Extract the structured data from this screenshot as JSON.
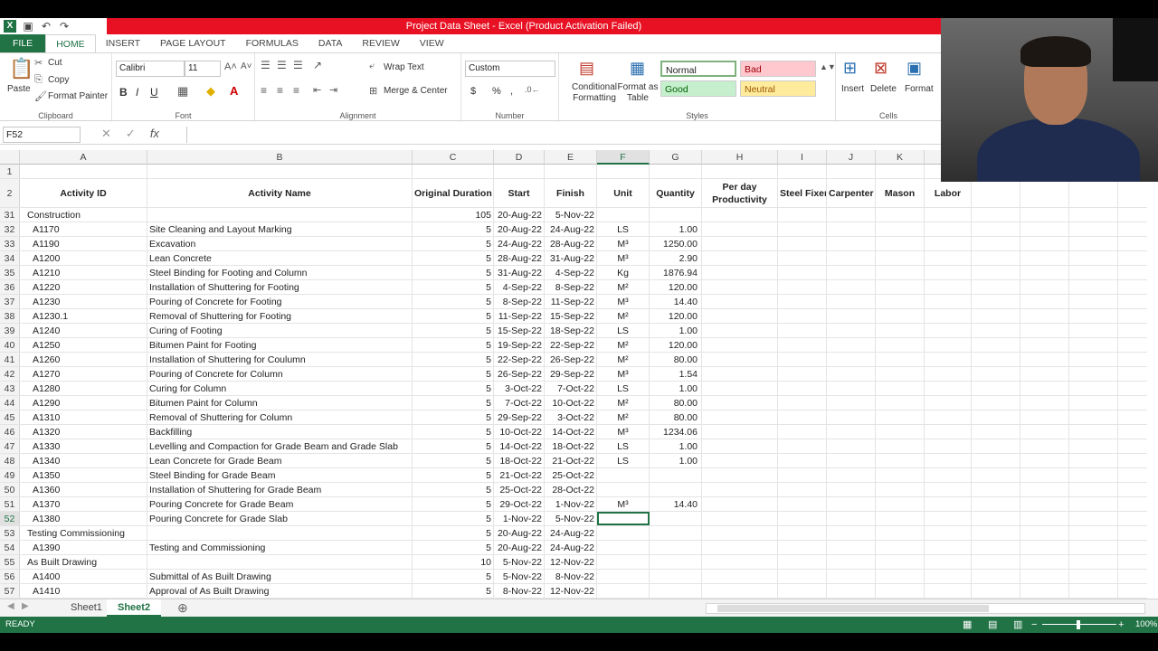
{
  "window": {
    "title": "Project Data Sheet -  Excel (Product Activation Failed)"
  },
  "ribbon_tabs": [
    {
      "label": "FILE"
    },
    {
      "label": "HOME"
    },
    {
      "label": "INSERT"
    },
    {
      "label": "PAGE LAYOUT"
    },
    {
      "label": "FORMULAS"
    },
    {
      "label": "DATA"
    },
    {
      "label": "REVIEW"
    },
    {
      "label": "VIEW"
    }
  ],
  "ribbon": {
    "clipboard": {
      "paste": "Paste",
      "cut": "Cut",
      "copy": "Copy",
      "format_painter": "Format Painter",
      "label": "Clipboard"
    },
    "font": {
      "name": "Calibri",
      "size": "11",
      "bold": "B",
      "italic": "I",
      "underline": "U",
      "label": "Font"
    },
    "alignment": {
      "wrap": "Wrap Text",
      "merge": "Merge & Center",
      "label": "Alignment"
    },
    "number": {
      "format": "Custom",
      "currency": "$",
      "percent": "%",
      "comma": ",",
      "label": "Number"
    },
    "styles": {
      "conditional": "Conditional Formatting",
      "format_table": "Format as Table",
      "normal": "Normal",
      "bad": "Bad",
      "good": "Good",
      "neutral": "Neutral",
      "label": "Styles"
    },
    "cells": {
      "insert": "Insert",
      "delete": "Delete",
      "format": "Format",
      "label": "Cells"
    }
  },
  "formula_bar": {
    "name_box": "F52",
    "fx": "fx",
    "content": ""
  },
  "columns": [
    "A",
    "B",
    "C",
    "D",
    "E",
    "F",
    "G",
    "H",
    "I",
    "J",
    "K"
  ],
  "selected_column": "F",
  "header_row": {
    "row_num": "2",
    "cells": [
      "Activity ID",
      "Activity Name",
      "Original Duration",
      "Start",
      "Finish",
      "Unit",
      "Quantity",
      "Per day Productivity",
      "Steel Fixer",
      "Carpenter",
      "Mason",
      "Labor"
    ]
  },
  "rows": [
    {
      "n": "31",
      "id": "Construction",
      "name": "",
      "dur": "105",
      "start": "20-Aug-22",
      "finish": "5-Nov-22",
      "unit": "",
      "qty": ""
    },
    {
      "n": "32",
      "id": "A1170",
      "name": "Site Cleaning and Layout Marking",
      "dur": "5",
      "start": "20-Aug-22",
      "finish": "24-Aug-22",
      "unit": "LS",
      "qty": "1.00"
    },
    {
      "n": "33",
      "id": "A1190",
      "name": "Excavation",
      "dur": "5",
      "start": "24-Aug-22",
      "finish": "28-Aug-22",
      "unit": "M³",
      "qty": "1250.00"
    },
    {
      "n": "34",
      "id": "A1200",
      "name": "Lean Concrete",
      "dur": "5",
      "start": "28-Aug-22",
      "finish": "31-Aug-22",
      "unit": "M³",
      "qty": "2.90"
    },
    {
      "n": "35",
      "id": "A1210",
      "name": "Steel Binding for Footing and Column",
      "dur": "5",
      "start": "31-Aug-22",
      "finish": "4-Sep-22",
      "unit": "Kg",
      "qty": "1876.94"
    },
    {
      "n": "36",
      "id": "A1220",
      "name": "Installation of Shuttering for Footing",
      "dur": "5",
      "start": "4-Sep-22",
      "finish": "8-Sep-22",
      "unit": "M²",
      "qty": "120.00"
    },
    {
      "n": "37",
      "id": "A1230",
      "name": "Pouring of Concrete for Footing",
      "dur": "5",
      "start": "8-Sep-22",
      "finish": "11-Sep-22",
      "unit": "M³",
      "qty": "14.40"
    },
    {
      "n": "38",
      "id": "A1230.1",
      "name": "Removal of Shuttering for Footing",
      "dur": "5",
      "start": "11-Sep-22",
      "finish": "15-Sep-22",
      "unit": "M²",
      "qty": "120.00"
    },
    {
      "n": "39",
      "id": "A1240",
      "name": "Curing of Footing",
      "dur": "5",
      "start": "15-Sep-22",
      "finish": "18-Sep-22",
      "unit": "LS",
      "qty": "1.00"
    },
    {
      "n": "40",
      "id": "A1250",
      "name": "Bitumen Paint for Footing",
      "dur": "5",
      "start": "19-Sep-22",
      "finish": "22-Sep-22",
      "unit": "M²",
      "qty": "120.00"
    },
    {
      "n": "41",
      "id": "A1260",
      "name": "Installation of Shuttering for Coulumn",
      "dur": "5",
      "start": "22-Sep-22",
      "finish": "26-Sep-22",
      "unit": "M²",
      "qty": "80.00"
    },
    {
      "n": "42",
      "id": "A1270",
      "name": "Pouring of Concrete for Column",
      "dur": "5",
      "start": "26-Sep-22",
      "finish": "29-Sep-22",
      "unit": "M³",
      "qty": "1.54"
    },
    {
      "n": "43",
      "id": "A1280",
      "name": "Curing for Column",
      "dur": "5",
      "start": "3-Oct-22",
      "finish": "7-Oct-22",
      "unit": "LS",
      "qty": "1.00"
    },
    {
      "n": "44",
      "id": "A1290",
      "name": "Bitumen Paint for Column",
      "dur": "5",
      "start": "7-Oct-22",
      "finish": "10-Oct-22",
      "unit": "M²",
      "qty": "80.00"
    },
    {
      "n": "45",
      "id": "A1310",
      "name": "Removal of Shuttering for Column",
      "dur": "5",
      "start": "29-Sep-22",
      "finish": "3-Oct-22",
      "unit": "M²",
      "qty": "80.00"
    },
    {
      "n": "46",
      "id": "A1320",
      "name": "Backfilling",
      "dur": "5",
      "start": "10-Oct-22",
      "finish": "14-Oct-22",
      "unit": "M³",
      "qty": "1234.06"
    },
    {
      "n": "47",
      "id": "A1330",
      "name": "Levelling and Compaction for Grade Beam and Grade Slab",
      "dur": "5",
      "start": "14-Oct-22",
      "finish": "18-Oct-22",
      "unit": "LS",
      "qty": "1.00"
    },
    {
      "n": "48",
      "id": "A1340",
      "name": "Lean Concrete for Grade Beam",
      "dur": "5",
      "start": "18-Oct-22",
      "finish": "21-Oct-22",
      "unit": "LS",
      "qty": "1.00"
    },
    {
      "n": "49",
      "id": "A1350",
      "name": "Steel Binding for Grade Beam",
      "dur": "5",
      "start": "21-Oct-22",
      "finish": "25-Oct-22",
      "unit": "",
      "qty": ""
    },
    {
      "n": "50",
      "id": "A1360",
      "name": "Installation of Shuttering for Grade Beam",
      "dur": "5",
      "start": "25-Oct-22",
      "finish": "28-Oct-22",
      "unit": "",
      "qty": ""
    },
    {
      "n": "51",
      "id": "A1370",
      "name": "Pouring Concrete for Grade Beam",
      "dur": "5",
      "start": "29-Oct-22",
      "finish": "1-Nov-22",
      "unit": "M³",
      "qty": "14.40"
    },
    {
      "n": "52",
      "id": "A1380",
      "name": "Pouring Concrete for Grade Slab",
      "dur": "5",
      "start": "1-Nov-22",
      "finish": "5-Nov-22",
      "unit": "",
      "qty": ""
    },
    {
      "n": "53",
      "id": "Testing Commissioning",
      "name": "",
      "dur": "5",
      "start": "20-Aug-22",
      "finish": "24-Aug-22",
      "unit": "",
      "qty": ""
    },
    {
      "n": "54",
      "id": "A1390",
      "name": "Testing and Commissioning",
      "dur": "5",
      "start": "20-Aug-22",
      "finish": "24-Aug-22",
      "unit": "",
      "qty": ""
    },
    {
      "n": "55",
      "id": "As Built Drawing",
      "name": "",
      "dur": "10",
      "start": "5-Nov-22",
      "finish": "12-Nov-22",
      "unit": "",
      "qty": ""
    },
    {
      "n": "56",
      "id": "A1400",
      "name": "Submittal of As Built Drawing",
      "dur": "5",
      "start": "5-Nov-22",
      "finish": "8-Nov-22",
      "unit": "",
      "qty": ""
    },
    {
      "n": "57",
      "id": "A1410",
      "name": "Approval of As Built Drawing",
      "dur": "5",
      "start": "8-Nov-22",
      "finish": "12-Nov-22",
      "unit": "",
      "qty": ""
    }
  ],
  "selected_row": "52",
  "sheets": [
    {
      "label": "Sheet1"
    },
    {
      "label": "Sheet2"
    }
  ],
  "active_sheet": "Sheet2",
  "status": {
    "mode": "READY",
    "zoom": "100%"
  },
  "colors": {
    "excel_green": "#217346",
    "title_red": "#e81123"
  }
}
